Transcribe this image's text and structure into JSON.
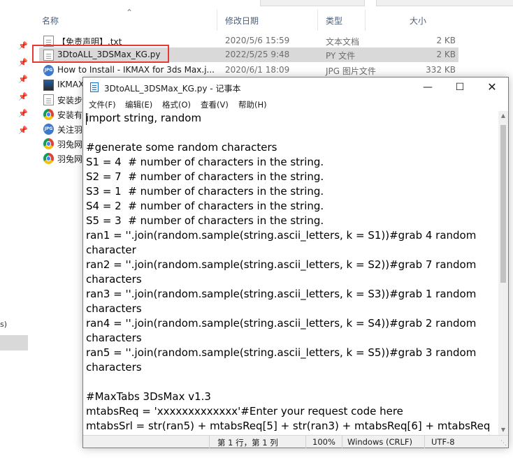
{
  "explorer": {
    "columns": {
      "name": "名称",
      "date": "修改日期",
      "type": "类型",
      "size": "大小"
    },
    "files": [
      {
        "name": "【免责声明】.txt",
        "date": "2020/5/6 15:59",
        "type": "文本文档",
        "size": "2 KB",
        "icon": "text-file-icon"
      },
      {
        "name": "3DtoALL_3DSMax_KG.py",
        "date": "2022/5/25 9:48",
        "type": "PY 文件",
        "size": "2 KB",
        "icon": "text-file-icon",
        "selected": true
      },
      {
        "name": "How to Install - IKMAX for 3ds Max.j...",
        "date": "2020/6/1 18:09",
        "type": "JPG 图片文件",
        "size": "332 KB",
        "icon": "jpg-file-icon"
      },
      {
        "name": "IKMAX",
        "icon": "exe-file-icon"
      },
      {
        "name": "安装步",
        "icon": "text-file-icon"
      },
      {
        "name": "安装有",
        "icon": "chrome-icon"
      },
      {
        "name": "关注羽",
        "icon": "jpg-file-icon"
      },
      {
        "name": "羽兔网",
        "icon": "chrome-icon"
      },
      {
        "name": "羽兔网",
        "icon": "chrome-icon"
      }
    ],
    "nav_fragment": "s)"
  },
  "notepad": {
    "title": "3DtoALL_3DSMax_KG.py - 记事本",
    "menu": [
      "文件(F)",
      "编辑(E)",
      "格式(O)",
      "查看(V)",
      "帮助(H)"
    ],
    "lines": [
      "import string, random",
      "",
      "#generate some random characters",
      "S1 = 4  # number of characters in the string.",
      "S2 = 7  # number of characters in the string.",
      "S3 = 1  # number of characters in the string.",
      "S4 = 2  # number of characters in the string.",
      "S5 = 3  # number of characters in the string.",
      "ran1 = ''.join(random.sample(string.ascii_letters, k = S1))#grab 4 random",
      "character",
      "ran2 = ''.join(random.sample(string.ascii_letters, k = S2))#grab 7 random",
      "characters",
      "ran3 = ''.join(random.sample(string.ascii_letters, k = S3))#grab 1 random",
      "characters",
      "ran4 = ''.join(random.sample(string.ascii_letters, k = S4))#grab 2 random",
      "characters",
      "ran5 = ''.join(random.sample(string.ascii_letters, k = S5))#grab 3 random",
      "characters",
      "",
      "#MaxTabs 3DsMax v1.3",
      "mtabsReq = 'xxxxxxxxxxxxx'#Enter your request code here",
      "mtabsSrl = str(ran5) + mtabsReq[5] + str(ran3) + mtabsReq[6] + mtabsReq"
    ],
    "status": {
      "position": "第 1 行，第 1 列",
      "zoom": "100%",
      "line_ending": "Windows (CRLF)",
      "encoding": "UTF-8"
    }
  }
}
